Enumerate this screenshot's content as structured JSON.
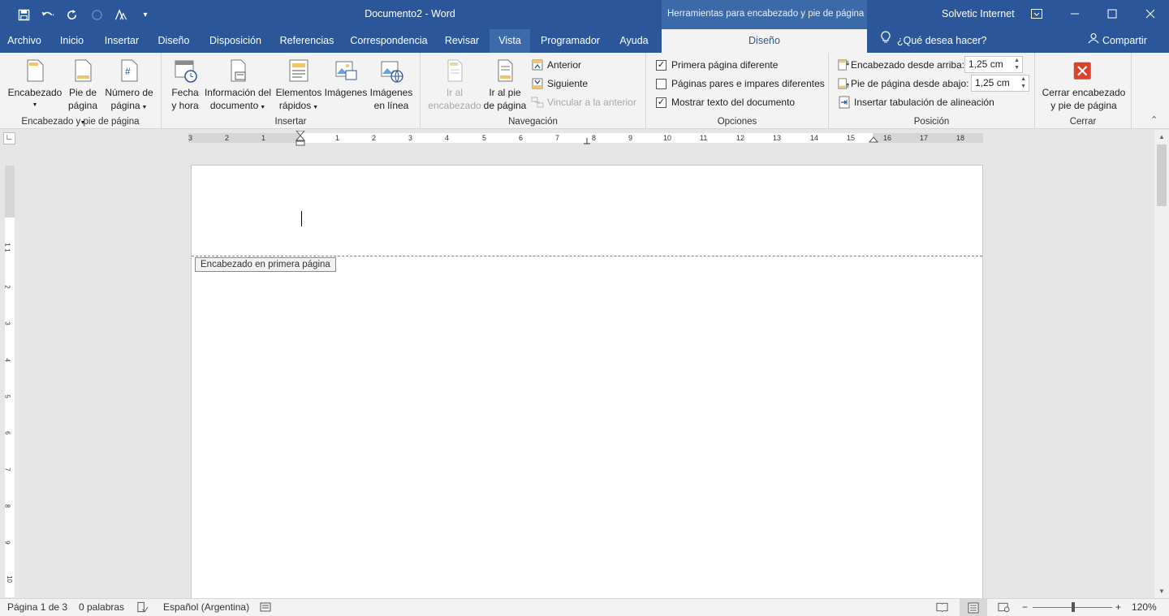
{
  "title_bar": {
    "doc_title": "Documento2  -  Word",
    "contextual_tools": "Herramientas para encabezado y pie de página",
    "account": "Solvetic Internet",
    "accent": "#2b579a"
  },
  "tabs": [
    "Archivo",
    "Inicio",
    "Insertar",
    "Diseño",
    "Disposición",
    "Referencias",
    "Correspondencia",
    "Revisar",
    "Vista",
    "Programador",
    "Ayuda"
  ],
  "contextual_tab": "Diseño",
  "tell_me": "¿Qué desea hacer?",
  "share": "Compartir",
  "ribbon": {
    "hf_group": {
      "label": "Encabezado y pie de página",
      "header_line1": "Encabezado",
      "footer_line1": "Pie de",
      "footer_line2": "página",
      "pagenum_line1": "Número de",
      "pagenum_line2": "página"
    },
    "insert_group": {
      "label": "Insertar",
      "date_line1": "Fecha",
      "date_line2": "y hora",
      "docinfo_line1": "Información del",
      "docinfo_line2": "documento",
      "quick_line1": "Elementos",
      "quick_line2": "rápidos",
      "pictures": "Imágenes",
      "online_line1": "Imágenes",
      "online_line2": "en línea"
    },
    "nav_group": {
      "label": "Navegación",
      "goto_header_line1": "Ir al",
      "goto_header_line2": "encabezado",
      "goto_footer_line1": "Ir al pie",
      "goto_footer_line2": "de página",
      "previous": "Anterior",
      "next": "Siguiente",
      "link_previous": "Vincular a la anterior"
    },
    "options_group": {
      "label": "Opciones",
      "first_page": "Primera página diferente",
      "odd_even": "Páginas pares e impares diferentes",
      "show_text": "Mostrar texto del documento",
      "first_page_checked": true,
      "odd_even_checked": false,
      "show_text_checked": true
    },
    "position_group": {
      "label": "Posición",
      "header_from_top": "Encabezado desde arriba:",
      "header_from_top_value": "1,25 cm",
      "footer_from_bottom": "Pie de página desde abajo:",
      "footer_from_bottom_value": "1,25 cm",
      "insert_tab": "Insertar tabulación de alineación"
    },
    "close_group": {
      "label": "Cerrar",
      "close_line1": "Cerrar encabezado",
      "close_line2": "y pie de página",
      "close_color": "#d9432b"
    }
  },
  "ruler": {
    "h_numbers": [
      "3",
      "2",
      "1",
      "1",
      "2",
      "3",
      "4",
      "5",
      "6",
      "7",
      "8",
      "9",
      "10",
      "11",
      "12",
      "13",
      "14",
      "15",
      "16",
      "17",
      "18"
    ],
    "v_numbers": [
      "1",
      "1",
      "2",
      "3",
      "4",
      "5",
      "6",
      "7",
      "8",
      "9",
      "10"
    ]
  },
  "document": {
    "header_tag": "Encabezado en primera página"
  },
  "status_bar": {
    "page": "Página 1 de 3",
    "words": "0 palabras",
    "language": "Español (Argentina)",
    "zoom": "120%",
    "zoom_level_percent": 120
  }
}
